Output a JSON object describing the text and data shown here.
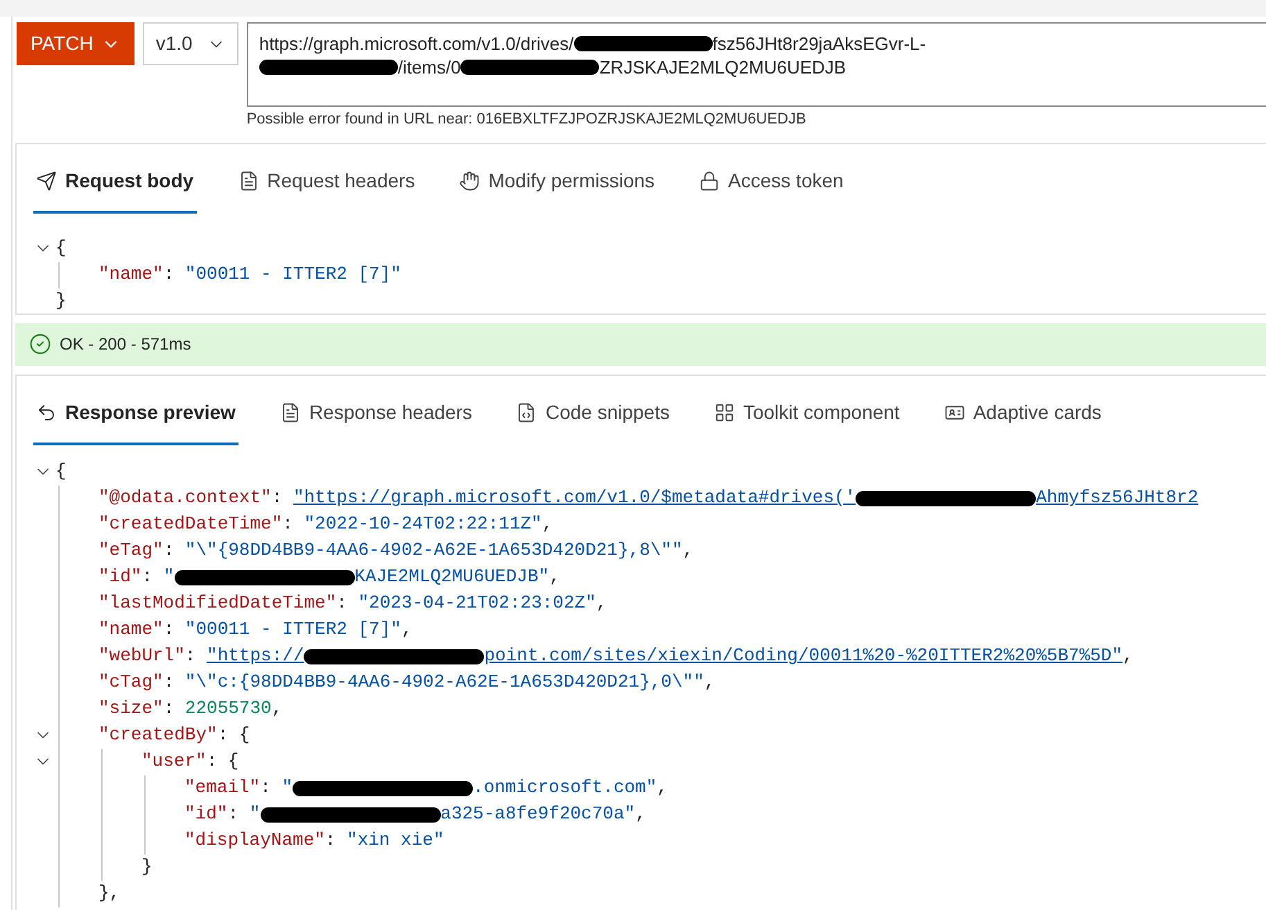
{
  "toolbar": {
    "method": "PATCH",
    "version": "v1.0",
    "url_lines": [
      [
        {
          "kind": "text",
          "text": "https://graph.microsoft.com/v1.0/drives/"
        },
        {
          "kind": "redacted"
        },
        {
          "kind": "text",
          "text": "fsz56JHt8r29jaAksEGvr-L-"
        }
      ],
      [
        {
          "kind": "redacted"
        },
        {
          "kind": "text",
          "text": "/items/0"
        },
        {
          "kind": "redacted"
        },
        {
          "kind": "text",
          "text": "ZRJSKAJE2MLQ2MU6UEDJB"
        }
      ]
    ],
    "url_warning": "Possible error found in URL near: 016EBXLTFZJPOZRJSKAJE2MLQ2MU6UEDJB"
  },
  "request": {
    "tabs": [
      {
        "label": "Request body",
        "selected": true
      },
      {
        "label": "Request headers",
        "selected": false
      },
      {
        "label": "Modify permissions",
        "selected": false
      },
      {
        "label": "Access token",
        "selected": false
      }
    ],
    "body": [
      {
        "tokens": [
          {
            "kind": "punct",
            "text": "{"
          }
        ],
        "expanded": true,
        "children": [
          {
            "tokens": [
              {
                "kind": "key",
                "text": "\"name\""
              },
              {
                "kind": "punct",
                "text": ": "
              },
              {
                "kind": "string",
                "text": "\"00011 - ITTER2 [7]\""
              }
            ]
          }
        ],
        "close": [
          {
            "kind": "punct",
            "text": "}"
          }
        ]
      }
    ]
  },
  "status": {
    "text": "OK - 200 - 571ms"
  },
  "response": {
    "tabs": [
      {
        "label": "Response preview",
        "selected": true
      },
      {
        "label": "Response headers",
        "selected": false
      },
      {
        "label": "Code snippets",
        "selected": false
      },
      {
        "label": "Toolkit component",
        "selected": false
      },
      {
        "label": "Adaptive cards",
        "selected": false
      }
    ],
    "body": [
      {
        "tokens": [
          {
            "kind": "punct",
            "text": "{"
          }
        ],
        "expanded": true,
        "children": [
          {
            "tokens": [
              {
                "kind": "key",
                "text": "\"@odata.context\""
              },
              {
                "kind": "punct",
                "text": ": "
              },
              {
                "kind": "link",
                "text": "\"https://graph.microsoft.com/v1.0/$metadata#drives('"
              },
              {
                "kind": "redacted"
              },
              {
                "kind": "link",
                "text": "Ahmyfsz56JHt8r2"
              }
            ]
          },
          {
            "tokens": [
              {
                "kind": "key",
                "text": "\"createdDateTime\""
              },
              {
                "kind": "punct",
                "text": ": "
              },
              {
                "kind": "string",
                "text": "\"2022-10-24T02:22:11Z\""
              },
              {
                "kind": "punct",
                "text": ","
              }
            ]
          },
          {
            "tokens": [
              {
                "kind": "key",
                "text": "\"eTag\""
              },
              {
                "kind": "punct",
                "text": ": "
              },
              {
                "kind": "string",
                "text": "\"\\\"{98DD4BB9-4AA6-4902-A62E-1A653D420D21},8\\\"\""
              },
              {
                "kind": "punct",
                "text": ","
              }
            ]
          },
          {
            "tokens": [
              {
                "kind": "key",
                "text": "\"id\""
              },
              {
                "kind": "punct",
                "text": ": "
              },
              {
                "kind": "string",
                "text": "\""
              },
              {
                "kind": "redacted"
              },
              {
                "kind": "string",
                "text": "KAJE2MLQ2MU6UEDJB\""
              },
              {
                "kind": "punct",
                "text": ","
              }
            ]
          },
          {
            "tokens": [
              {
                "kind": "key",
                "text": "\"lastModifiedDateTime\""
              },
              {
                "kind": "punct",
                "text": ": "
              },
              {
                "kind": "string",
                "text": "\"2023-04-21T02:23:02Z\""
              },
              {
                "kind": "punct",
                "text": ","
              }
            ]
          },
          {
            "tokens": [
              {
                "kind": "key",
                "text": "\"name\""
              },
              {
                "kind": "punct",
                "text": ": "
              },
              {
                "kind": "string",
                "text": "\"00011 - ITTER2 [7]\""
              },
              {
                "kind": "punct",
                "text": ","
              }
            ]
          },
          {
            "tokens": [
              {
                "kind": "key",
                "text": "\"webUrl\""
              },
              {
                "kind": "punct",
                "text": ": "
              },
              {
                "kind": "link",
                "text": "\"https://"
              },
              {
                "kind": "redacted"
              },
              {
                "kind": "link",
                "text": "point.com/sites/xiexin/Coding/00011%20-%20ITTER2%20%5B7%5D\""
              },
              {
                "kind": "punct",
                "text": ","
              }
            ]
          },
          {
            "tokens": [
              {
                "kind": "key",
                "text": "\"cTag\""
              },
              {
                "kind": "punct",
                "text": ": "
              },
              {
                "kind": "string",
                "text": "\"\\\"c:{98DD4BB9-4AA6-4902-A62E-1A653D420D21},0\\\"\""
              },
              {
                "kind": "punct",
                "text": ","
              }
            ]
          },
          {
            "tokens": [
              {
                "kind": "key",
                "text": "\"size\""
              },
              {
                "kind": "punct",
                "text": ": "
              },
              {
                "kind": "number",
                "text": "22055730"
              },
              {
                "kind": "punct",
                "text": ","
              }
            ]
          },
          {
            "tokens": [
              {
                "kind": "key",
                "text": "\"createdBy\""
              },
              {
                "kind": "punct",
                "text": ": {"
              }
            ],
            "expanded": true,
            "children": [
              {
                "tokens": [
                  {
                    "kind": "key",
                    "text": "\"user\""
                  },
                  {
                    "kind": "punct",
                    "text": ": {"
                  }
                ],
                "expanded": true,
                "children": [
                  {
                    "tokens": [
                      {
                        "kind": "key",
                        "text": "\"email\""
                      },
                      {
                        "kind": "punct",
                        "text": ": "
                      },
                      {
                        "kind": "string",
                        "text": "\""
                      },
                      {
                        "kind": "redacted"
                      },
                      {
                        "kind": "string",
                        "text": ".onmicrosoft.com\""
                      },
                      {
                        "kind": "punct",
                        "text": ","
                      }
                    ]
                  },
                  {
                    "tokens": [
                      {
                        "kind": "key",
                        "text": "\"id\""
                      },
                      {
                        "kind": "punct",
                        "text": ": "
                      },
                      {
                        "kind": "string",
                        "text": "\""
                      },
                      {
                        "kind": "redacted"
                      },
                      {
                        "kind": "string",
                        "text": "a325-a8fe9f20c70a\""
                      },
                      {
                        "kind": "punct",
                        "text": ","
                      }
                    ]
                  },
                  {
                    "tokens": [
                      {
                        "kind": "key",
                        "text": "\"displayName\""
                      },
                      {
                        "kind": "punct",
                        "text": ": "
                      },
                      {
                        "kind": "string",
                        "text": "\"xin xie\""
                      }
                    ]
                  }
                ],
                "close": [
                  {
                    "kind": "punct",
                    "text": "}"
                  }
                ]
              }
            ],
            "close": [
              {
                "kind": "punct",
                "text": "},"
              }
            ]
          }
        ]
      }
    ]
  }
}
